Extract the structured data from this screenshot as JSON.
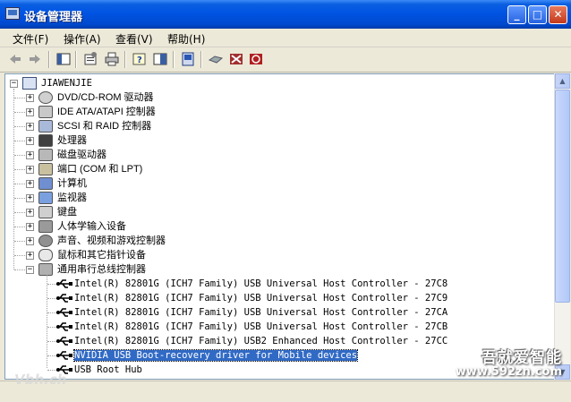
{
  "window": {
    "title": "设备管理器",
    "buttons": {
      "minimize": "_",
      "maximize": "□",
      "close": "✕"
    }
  },
  "menu": [
    {
      "label": "文件(F)"
    },
    {
      "label": "操作(A)"
    },
    {
      "label": "查看(V)"
    },
    {
      "label": "帮助(H)"
    }
  ],
  "toolbar": [
    "back-arrow-icon",
    "forward-arrow-icon",
    "show-hide-console-tree-icon",
    "properties-icon",
    "print-icon",
    "help-icon",
    "export-list-icon",
    "scan-hardware-icon",
    "update-driver-icon",
    "disable-device-icon",
    "uninstall-device-icon"
  ],
  "tree": {
    "root": "JIAWENJIE",
    "categories": [
      {
        "label": "DVD/CD-ROM 驱动器"
      },
      {
        "label": "IDE ATA/ATAPI 控制器"
      },
      {
        "label": "SCSI 和 RAID 控制器"
      },
      {
        "label": "处理器"
      },
      {
        "label": "磁盘驱动器"
      },
      {
        "label": "端口 (COM 和 LPT)"
      },
      {
        "label": "计算机"
      },
      {
        "label": "监视器"
      },
      {
        "label": "键盘"
      },
      {
        "label": "人体学输入设备"
      },
      {
        "label": "声音、视频和游戏控制器"
      },
      {
        "label": "鼠标和其它指针设备"
      },
      {
        "label": "通用串行总线控制器"
      }
    ],
    "usb_devices": [
      {
        "label": "Intel(R) 82801G (ICH7 Family) USB Universal Host Controller - 27C8"
      },
      {
        "label": "Intel(R) 82801G (ICH7 Family) USB Universal Host Controller - 27C9"
      },
      {
        "label": "Intel(R) 82801G (ICH7 Family) USB Universal Host Controller - 27CA"
      },
      {
        "label": "Intel(R) 82801G (ICH7 Family) USB Universal Host Controller - 27CB"
      },
      {
        "label": "Intel(R) 82801G (ICH7 Family) USB2 Enhanced Host Controller - 27CC"
      },
      {
        "label": "NVIDIA USB Boot-recovery driver for Mobile devices"
      },
      {
        "label": "USB Root Hub"
      }
    ],
    "selected_index": 5
  },
  "watermark": {
    "brand": "吾就爱智能",
    "url": "www.592zn.com",
    "left": "Vbh.ch"
  },
  "colors": {
    "titlebar": "#0054e3",
    "selection": "#316ac5",
    "window_bg": "#ece9d8"
  }
}
